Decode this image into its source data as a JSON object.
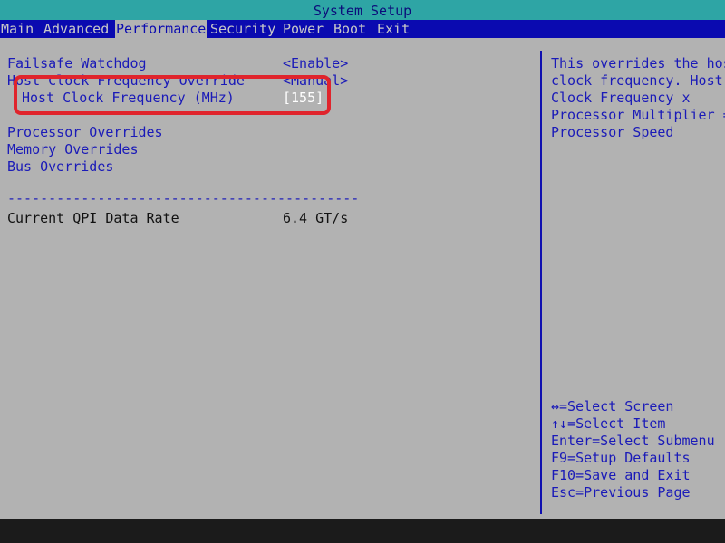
{
  "title": "System Setup",
  "menu": [
    {
      "label": "Main"
    },
    {
      "label": "Advanced"
    },
    {
      "label": "Performance"
    },
    {
      "label": "Security"
    },
    {
      "label": "Power"
    },
    {
      "label": "Boot"
    },
    {
      "label": "Exit"
    }
  ],
  "active_menu": "Performance",
  "settings": {
    "failsafe_watchdog": {
      "label": "Failsafe Watchdog",
      "value": "<Enable>"
    },
    "host_clock_override": {
      "label": "Host Clock Frequency Override",
      "value": "<Manual>"
    },
    "host_clock_frequency": {
      "label": "Host Clock Frequency (MHz)",
      "value": "[155]"
    }
  },
  "submenus": [
    {
      "label": "Processor Overrides"
    },
    {
      "label": "Memory Overrides"
    },
    {
      "label": "Bus Overrides"
    }
  ],
  "separator": "------------------------------------------------",
  "info": {
    "qpi_label": "Current QPI Data Rate",
    "qpi_value": "6.4 GT/s"
  },
  "help": {
    "lines": [
      "This overrides the host",
      "clock frequency. Host",
      "Clock Frequency x",
      "Processor Multiplier =",
      "Processor Speed"
    ]
  },
  "keys": [
    "↔=Select Screen",
    "↑↓=Select Item",
    "Enter=Select Submenu",
    "F9=Setup Defaults",
    "F10=Save and Exit",
    "Esc=Previous Page"
  ],
  "colors": {
    "title_bar": "#2ea5a5",
    "menu_bar": "#0a0ab0",
    "background": "#b2b2b2",
    "text_blue": "#1a1ab8",
    "highlight_red": "#e0242c"
  }
}
